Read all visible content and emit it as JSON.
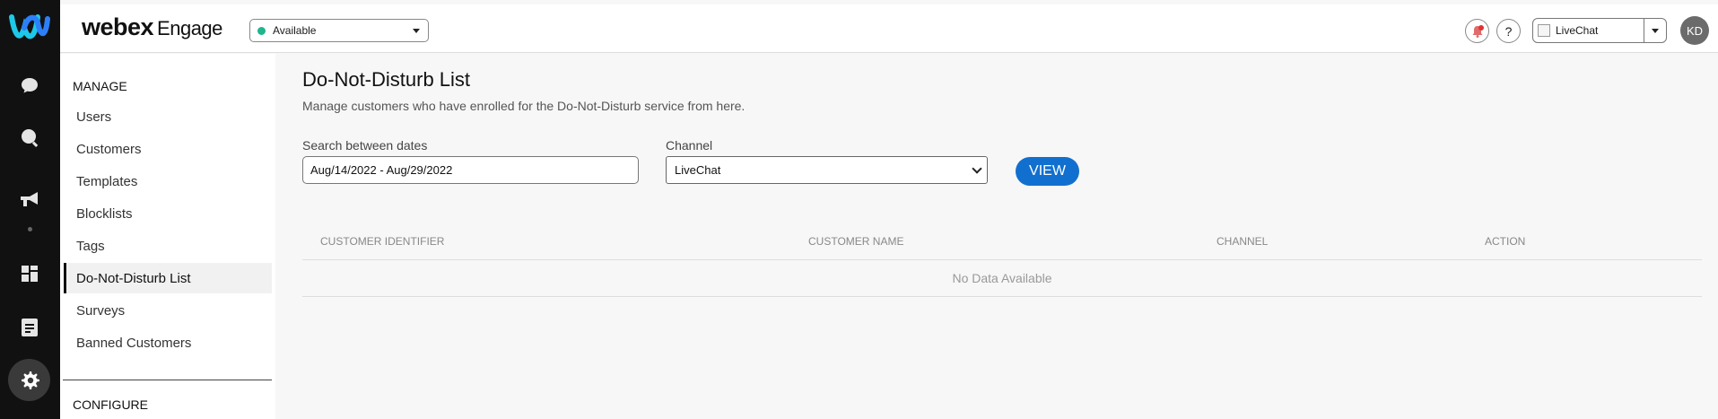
{
  "header": {
    "brand_main": "webex",
    "brand_sub": "Engage",
    "status": "Available",
    "channel": "LiveChat",
    "help_label": "?",
    "avatar_initials": "KD"
  },
  "sidebar": {
    "section_manage": "MANAGE",
    "items": [
      {
        "label": "Users"
      },
      {
        "label": "Customers"
      },
      {
        "label": "Templates"
      },
      {
        "label": "Blocklists"
      },
      {
        "label": "Tags"
      },
      {
        "label": "Do-Not-Disturb List",
        "active": true
      },
      {
        "label": "Surveys"
      },
      {
        "label": "Banned Customers"
      }
    ],
    "section_configure": "CONFIGURE"
  },
  "main": {
    "title": "Do-Not-Disturb List",
    "subtitle": "Manage customers who have enrolled for the Do-Not-Disturb service from here.",
    "date_label": "Search between dates",
    "date_value": "Aug/14/2022 - Aug/29/2022",
    "channel_label": "Channel",
    "channel_value": "LiveChat",
    "view_button": "VIEW"
  },
  "table": {
    "columns": [
      "CUSTOMER IDENTIFIER",
      "CUSTOMER NAME",
      "CHANNEL",
      "ACTION"
    ],
    "empty_message": "No Data Available"
  },
  "colors": {
    "accent": "#1170cf",
    "status_available": "#1fb58f",
    "rail_bg": "#111111"
  },
  "icons": [
    "webex-logo-icon",
    "chat-icon",
    "search-icon",
    "megaphone-icon",
    "dashboard-icon",
    "notes-icon",
    "gear-icon",
    "notification-icon",
    "help-icon",
    "chevron-down-icon"
  ]
}
